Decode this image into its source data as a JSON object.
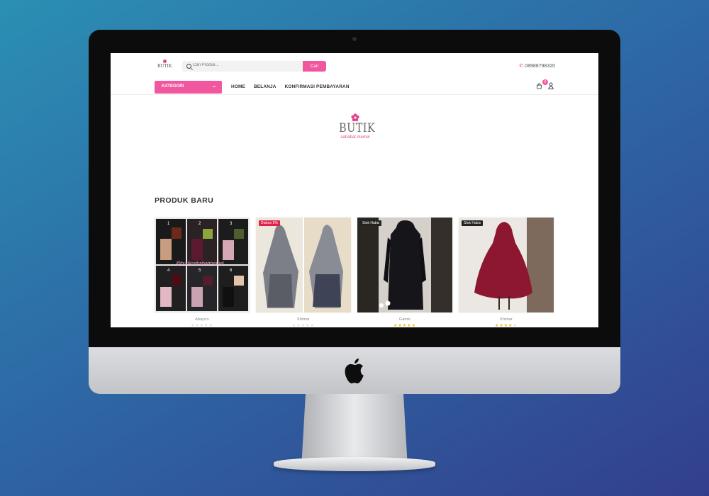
{
  "header": {
    "logo_text": "BUTIK",
    "search_placeholder": "Cari Produk...",
    "search_button": "Cari",
    "phone": "08988798320",
    "cart_count": "0"
  },
  "nav": {
    "kategori_label": "KATEGORI",
    "items": [
      "HOME",
      "BELANJA",
      "KONFIRMASI PEMBAYARAN"
    ]
  },
  "hero": {
    "brand": "BUTIK",
    "tagline": "sahabat memel"
  },
  "section": {
    "title": "PRODUK BARU"
  },
  "products": [
    {
      "name": "Abaya's",
      "badge": "",
      "rating": 0,
      "watermark": "@butiksahabatmemel"
    },
    {
      "name": "Khimar",
      "badge": "Diskon 5%",
      "rating": 0
    },
    {
      "name": "Gamis",
      "badge": "Stok Habis",
      "rating": 5
    },
    {
      "name": "Khimar",
      "badge": "Stok Habis",
      "rating": 4
    }
  ],
  "colors": {
    "accent": "#f1579f",
    "discount_badge": "#e2204b",
    "stock_badge": "#222222",
    "star_filled": "#f3b415",
    "star_empty": "#dddddd"
  }
}
